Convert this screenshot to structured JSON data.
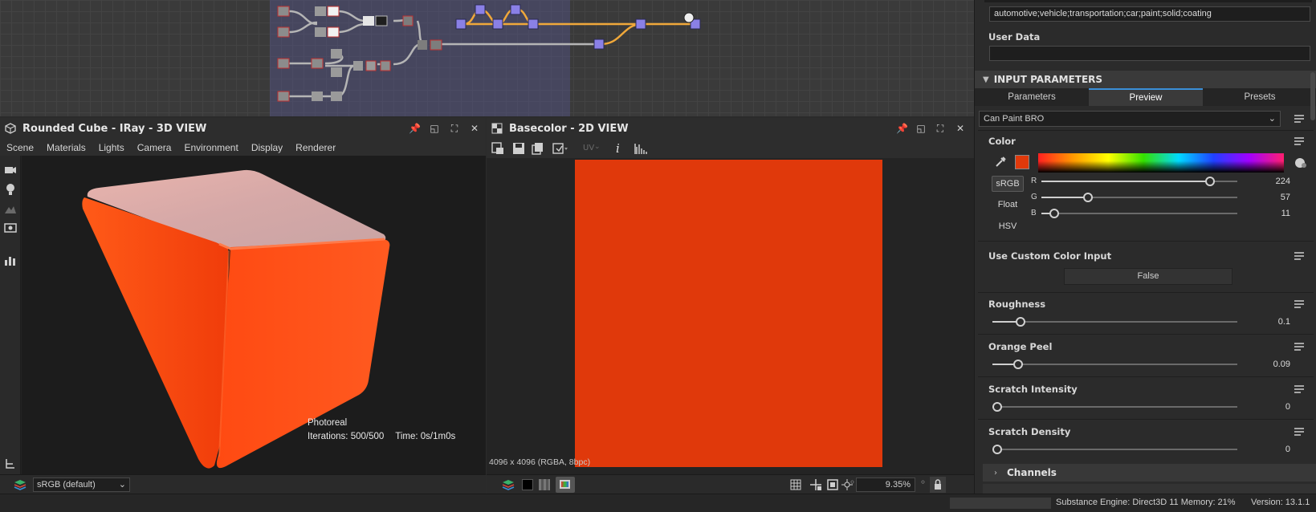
{
  "graph": {
    "nodes_note": ""
  },
  "view3d": {
    "title": "Rounded Cube - IRay - 3D VIEW",
    "menu": [
      "Scene",
      "Materials",
      "Lights",
      "Camera",
      "Environment",
      "Display",
      "Renderer"
    ],
    "render_mode": "Photoreal",
    "iterations": "Iterations: 500/500",
    "time": "Time: 0s/1m0s",
    "colorspace": "sRGB (default)",
    "cube_color": "#ff4a14"
  },
  "view2d": {
    "title": "Basecolor - 2D VIEW",
    "uv_label": "UV",
    "resolution": "4096 x 4096 (RGBA, 8bpc)",
    "zoom": "9.35%",
    "texture_color": "#e0390b"
  },
  "props": {
    "tags_value": "automotive;vehicle;transportation;car;paint;solid;coating",
    "user_data_label": "User Data",
    "user_data_value": "",
    "input_params_header": "INPUT PARAMETERS",
    "tabs": [
      "Parameters",
      "Preview",
      "Presets"
    ],
    "active_tab": "Preview",
    "preset": "Can Paint BRO",
    "color_label": "Color",
    "swatch_color": "#e0390b",
    "modes": [
      "sRGB",
      "Float",
      "HSV"
    ],
    "r_label": "R",
    "g_label": "G",
    "b_label": "B",
    "r_value": "224",
    "g_value": "57",
    "b_value": "11",
    "r": 224,
    "g": 57,
    "b": 11,
    "custom_color_label": "Use Custom Color Input",
    "custom_color_value": "False",
    "roughness_label": "Roughness",
    "roughness_value": "0.1",
    "roughness": 0.1,
    "orange_peel_label": "Orange Peel",
    "orange_peel_value": "0.09",
    "orange_peel": 0.09,
    "scratch_intensity_label": "Scratch Intensity",
    "scratch_intensity_value": "0",
    "scratch_intensity": 0,
    "scratch_density_label": "Scratch Density",
    "scratch_density_value": "0",
    "scratch_density": 0,
    "channels_label": "Channels"
  },
  "status": {
    "engine": "Substance Engine: Direct3D 11  Memory: 21%",
    "version": "Version: 13.1.1"
  }
}
